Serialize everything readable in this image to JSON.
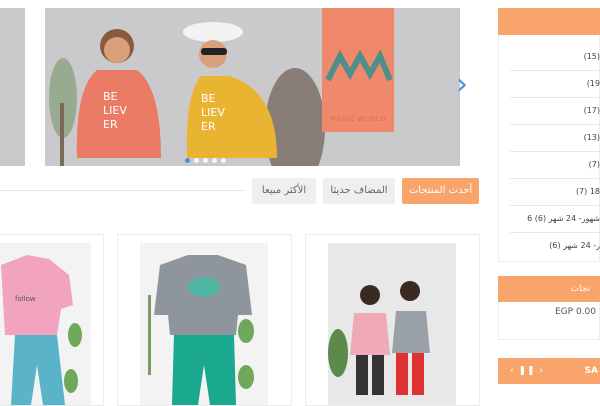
{
  "tabs": {
    "newest": "أحدث المنتجات",
    "recent": "المضاف حديثا",
    "best": "الأكثر مبيعا"
  },
  "slider": {
    "brand": "MAGIC WORLD",
    "next_icon": "chevron-right-icon",
    "dots": 5,
    "active_dot": 1
  },
  "sidebar": {
    "items": [
      "(15)",
      "(19",
      "(17)",
      "(13)",
      "(7)",
      "(7) 18",
      "6 شهور- 24 شهر (6)",
      "ر- 24 شهر (6)"
    ]
  },
  "cart": {
    "title": "نجات",
    "total": "EGP 0.00"
  },
  "sale": {
    "label": "SA",
    "controls": "‹ ❚❚ ›"
  },
  "colors": {
    "accent": "#f9a46b",
    "link": "#4a90e2",
    "brand_panel": "#f0896b"
  }
}
